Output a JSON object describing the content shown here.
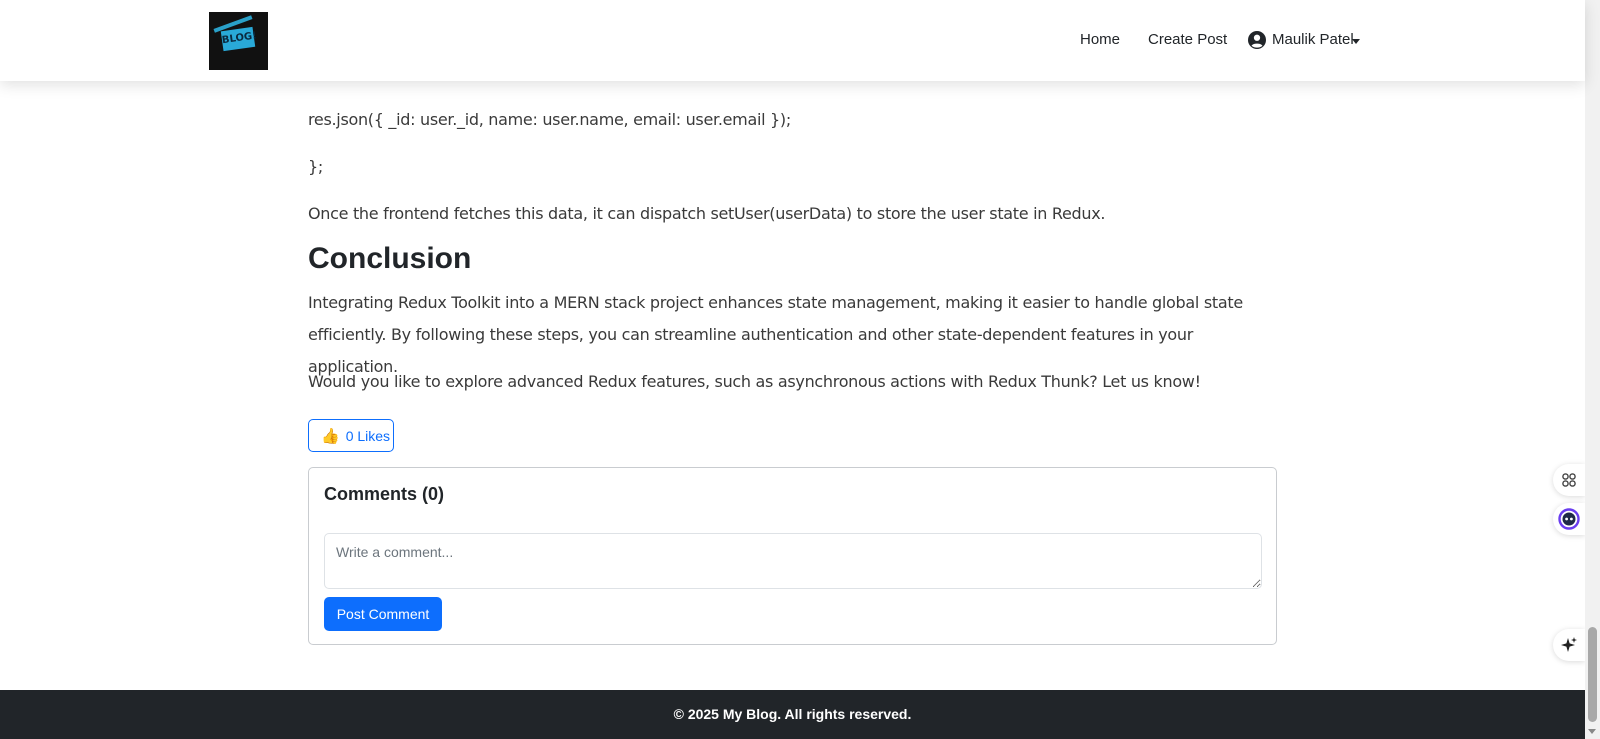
{
  "navbar": {
    "logo_text": "BLOG!",
    "links": {
      "home": "Home",
      "create_post": "Create Post",
      "user": "Maulik Patel"
    }
  },
  "article": {
    "code_line_1": "res.json({ _id: user._id, name: user.name, email: user.email });",
    "code_line_2": "};",
    "para_dispatch": "Once the frontend fetches this data, it can dispatch setUser(userData) to store the user state in Redux.",
    "conclusion_heading": "Conclusion",
    "conclusion_para": "Integrating Redux Toolkit into a MERN stack project enhances state management, making it easier to handle global state efficiently. By following these steps, you can streamline authentication and other state-dependent features in your application.",
    "closing_para": "Would you like to explore advanced Redux features, such as asynchronous actions with Redux Thunk? Let us know!"
  },
  "likes": {
    "icon": "thumbs-up-icon",
    "label": "0 Likes"
  },
  "comments": {
    "title": "Comments (0)",
    "placeholder": "Write a comment...",
    "post_button": "Post Comment"
  },
  "footer": {
    "text": "© 2025 My Blog. All rights reserved."
  },
  "colors": {
    "primary": "#0d6efd",
    "footer_bg": "#212529"
  }
}
